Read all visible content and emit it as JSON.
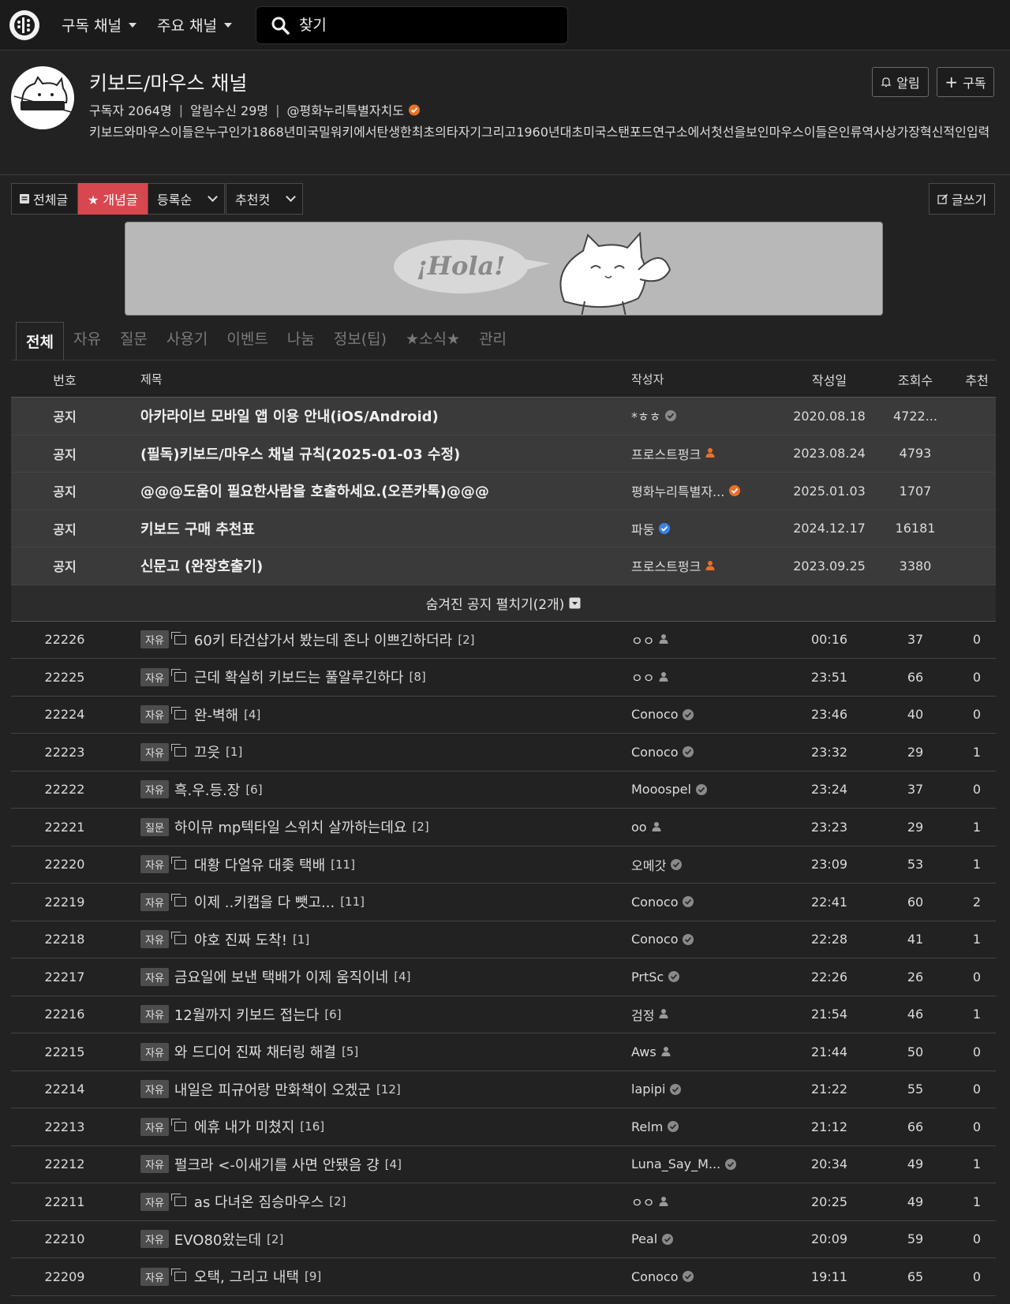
{
  "nav": {
    "menu1": "구독 채널",
    "menu2": "주요 채널",
    "search_placeholder": "찾기"
  },
  "channel": {
    "title": "키보드/마우스 채널",
    "subscribers": "구독자 2064명",
    "notify": "알림수신 29명",
    "owner": "@평화누리특별자치도",
    "description": "키보드와마우스이들은누구인가1868년미국밀워키에서탄생한최초의타자기그리고1960년대초미국스탠포드연구소에서첫선을보인마우스이들은인류역사상가장혁신적인입력",
    "alarm_label": "알림",
    "subscribe_label": "구독"
  },
  "toolbar": {
    "all_label": "전체글",
    "best_label": "★ 개념글",
    "sort_label": "등록순",
    "rec_label": "추천컷",
    "write_label": "글쓰기"
  },
  "banner": {
    "text": "¡Hola!"
  },
  "tabs": [
    "전체",
    "자유",
    "질문",
    "사용기",
    "이벤트",
    "나눔",
    "정보(팁)",
    "★소식★",
    "관리"
  ],
  "columns": {
    "num": "번호",
    "title": "제목",
    "author": "작성자",
    "date": "작성일",
    "views": "조회수",
    "rec": "추천"
  },
  "notices": [
    {
      "num": "공지",
      "title": "아카라이브 모바일 앱 이용 안내(iOS/Android)",
      "author": "*ㅎㅎ",
      "badge": "gray",
      "date": "2020.08.18",
      "views": "4722...",
      "rec": ""
    },
    {
      "num": "공지",
      "title": "(필독)키보드/마우스 채널 규칙(2025-01-03 수정)",
      "author": "프로스트펑크",
      "badge": "person-orange",
      "date": "2023.08.24",
      "views": "4793",
      "rec": ""
    },
    {
      "num": "공지",
      "title": "@@@도움이 필요한사람을 호출하세요.(오픈카톡)@@@",
      "author": "평화누리특별자...",
      "badge": "orange",
      "date": "2025.01.03",
      "views": "1707",
      "rec": ""
    },
    {
      "num": "공지",
      "title": "키보드 구매 추천표",
      "author": "파둥",
      "badge": "blue",
      "date": "2024.12.17",
      "views": "16181",
      "rec": ""
    },
    {
      "num": "공지",
      "title": "신문고 (완장호출기)",
      "author": "프로스트펑크",
      "badge": "person-orange",
      "date": "2023.09.25",
      "views": "3380",
      "rec": ""
    }
  ],
  "hidden_notice": "숨겨진 공지 펼치기(2개)",
  "posts": [
    {
      "num": "22226",
      "cat": "자유",
      "img": true,
      "title": "60키 타건샵가서 봤는데 존나 이쁘긴하더라",
      "comments": "[2]",
      "author": "ㅇㅇ",
      "badge": "person",
      "date": "00:16",
      "views": "37",
      "rec": "0"
    },
    {
      "num": "22225",
      "cat": "자유",
      "img": true,
      "title": "근데 확실히 키보드는 풀알루긴하다",
      "comments": "[8]",
      "author": "ㅇㅇ",
      "badge": "person",
      "date": "23:51",
      "views": "66",
      "rec": "0"
    },
    {
      "num": "22224",
      "cat": "자유",
      "img": true,
      "title": "완-벽해",
      "comments": "[4]",
      "author": "Conoco",
      "badge": "gray",
      "date": "23:46",
      "views": "40",
      "rec": "0"
    },
    {
      "num": "22223",
      "cat": "자유",
      "img": true,
      "title": "끄읏",
      "comments": "[1]",
      "author": "Conoco",
      "badge": "gray",
      "date": "23:32",
      "views": "29",
      "rec": "1"
    },
    {
      "num": "22222",
      "cat": "자유",
      "img": false,
      "title": "흑.우.등.장",
      "comments": "[6]",
      "author": "Mooospel",
      "badge": "gray",
      "date": "23:24",
      "views": "37",
      "rec": "0"
    },
    {
      "num": "22221",
      "cat": "질문",
      "img": false,
      "title": "하이뮤 mp텍타일 스위치 살까하는데요",
      "comments": "[2]",
      "author": "oo",
      "badge": "person",
      "date": "23:23",
      "views": "29",
      "rec": "1"
    },
    {
      "num": "22220",
      "cat": "자유",
      "img": true,
      "title": "대황 다얼유 대좆 택배",
      "comments": "[11]",
      "author": "오메갓",
      "badge": "gray",
      "date": "23:09",
      "views": "53",
      "rec": "1"
    },
    {
      "num": "22219",
      "cat": "자유",
      "img": true,
      "title": "이제 ..키캡을 다 뺏고...",
      "comments": "[11]",
      "author": "Conoco",
      "badge": "gray",
      "date": "22:41",
      "views": "60",
      "rec": "2"
    },
    {
      "num": "22218",
      "cat": "자유",
      "img": true,
      "title": "야호 진짜 도착!",
      "comments": "[1]",
      "author": "Conoco",
      "badge": "gray",
      "date": "22:28",
      "views": "41",
      "rec": "1"
    },
    {
      "num": "22217",
      "cat": "자유",
      "img": false,
      "title": "금요일에 보낸 택배가 이제 움직이네",
      "comments": "[4]",
      "author": "PrtSc",
      "badge": "gray",
      "date": "22:26",
      "views": "26",
      "rec": "0"
    },
    {
      "num": "22216",
      "cat": "자유",
      "img": false,
      "title": "12월까지 키보드 접는다",
      "comments": "[6]",
      "author": "검정",
      "badge": "person",
      "date": "21:54",
      "views": "46",
      "rec": "1"
    },
    {
      "num": "22215",
      "cat": "자유",
      "img": false,
      "title": "와 드디어 진짜 채터링 해결",
      "comments": "[5]",
      "author": "Aws",
      "badge": "person",
      "date": "21:44",
      "views": "50",
      "rec": "0"
    },
    {
      "num": "22214",
      "cat": "자유",
      "img": false,
      "title": "내일은 피규어랑 만화책이 오겠군",
      "comments": "[12]",
      "author": "lapipi",
      "badge": "gray",
      "date": "21:22",
      "views": "55",
      "rec": "0"
    },
    {
      "num": "22213",
      "cat": "자유",
      "img": true,
      "title": "에휴 내가 미쳤지",
      "comments": "[16]",
      "author": "Relm",
      "badge": "gray",
      "date": "21:12",
      "views": "66",
      "rec": "0"
    },
    {
      "num": "22212",
      "cat": "자유",
      "img": false,
      "title": "펄크라 <-이새기를 사면 안됐음 걍",
      "comments": "[4]",
      "author": "Luna_Say_M...",
      "badge": "gray",
      "date": "20:34",
      "views": "49",
      "rec": "1"
    },
    {
      "num": "22211",
      "cat": "자유",
      "img": true,
      "title": "as 다녀온 짐승마우스",
      "comments": "[2]",
      "author": "ㅇㅇ",
      "badge": "person",
      "date": "20:25",
      "views": "49",
      "rec": "1"
    },
    {
      "num": "22210",
      "cat": "자유",
      "img": false,
      "title": "EVO80왔는데",
      "comments": "[2]",
      "author": "Peal",
      "badge": "gray",
      "date": "20:09",
      "views": "59",
      "rec": "0"
    },
    {
      "num": "22209",
      "cat": "자유",
      "img": true,
      "title": "오택, 그리고 내택",
      "comments": "[9]",
      "author": "Conoco",
      "badge": "gray",
      "date": "19:11",
      "views": "65",
      "rec": "0"
    }
  ],
  "colors": {
    "accent": "#d8474f",
    "verified_orange": "#e8702a",
    "verified_blue": "#3b82e6",
    "badge_gray": "#8a8a8a"
  }
}
